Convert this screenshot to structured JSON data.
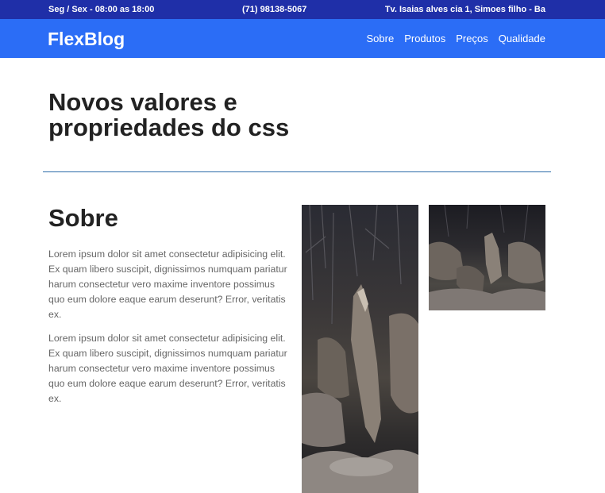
{
  "topbar": {
    "hours": "Seg / Sex - 08:00 as 18:00",
    "phone": "(71) 98138-5067",
    "address": "Tv. Isaias alves cia 1, Simoes filho - Ba"
  },
  "nav": {
    "logo": "FlexBlog",
    "links": [
      "Sobre",
      "Produtos",
      "Preços",
      "Qualidade"
    ]
  },
  "hero": {
    "title": "Novos valores e propriedades do css"
  },
  "about": {
    "title": "Sobre",
    "paragraphs": [
      "Lorem ipsum dolor sit amet consectetur adipisicing elit. Ex quam libero suscipit, dignissimos numquam pariatur harum consectetur vero maxime inventore possimus quo eum dolore eaque earum deserunt? Error, veritatis ex.",
      "Lorem ipsum dolor sit amet consectetur adipisicing elit. Ex quam libero suscipit, dignissimos numquam pariatur harum consectetur vero maxime inventore possimus quo eum dolore eaque earum deserunt? Error, veritatis ex."
    ]
  },
  "colors": {
    "topbar_bg": "#1f2fa8",
    "navbar_bg": "#2b6df6",
    "divider": "#2b6aa8"
  }
}
